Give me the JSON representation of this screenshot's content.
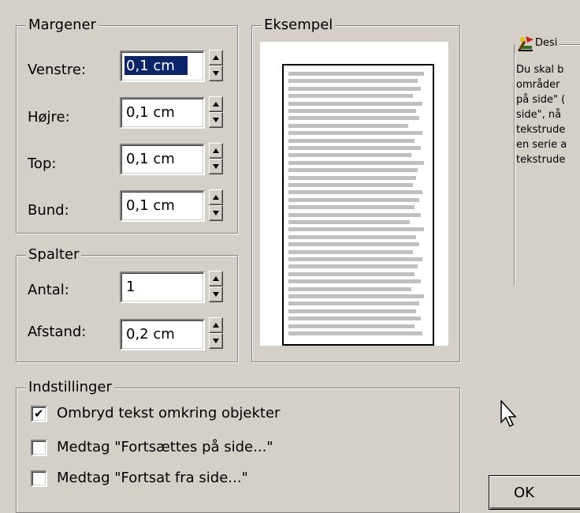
{
  "margins": {
    "legend": "Margener",
    "left_label": "Venstre:",
    "left_value": "0,1 cm",
    "right_label": "Højre:",
    "right_value": "0,1 cm",
    "top_label": "Top:",
    "top_value": "0,1 cm",
    "bottom_label": "Bund:",
    "bottom_value": "0,1 cm"
  },
  "columns": {
    "legend": "Spalter",
    "count_label": "Antal:",
    "count_value": "1",
    "spacing_label": "Afstand:",
    "spacing_value": "0,2 cm"
  },
  "preview": {
    "legend": "Eksempel"
  },
  "settings": {
    "legend": "Indstillinger",
    "options": [
      {
        "label": "Ombryd tekst omkring objekter",
        "checked": true
      },
      {
        "label": "Medtag \"Fortsættes på side...\"",
        "checked": false
      },
      {
        "label": "Medtag \"Fortsat fra side...\"",
        "checked": false
      }
    ]
  },
  "design_tip": {
    "title": "Desi",
    "lines": [
      "Du skal b",
      "områder",
      "på side\" (",
      "side\", nå",
      "tekstrude",
      "en serie a",
      "tekstrude"
    ]
  },
  "ok_label": "OK"
}
